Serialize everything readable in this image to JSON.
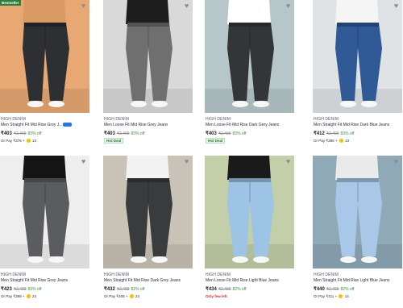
{
  "products": [
    {
      "badge": "Bestseller",
      "brand": "HIGH DENIM",
      "title": "Men Straight Fit Mid Rise Grey J...",
      "assured": true,
      "assured_label": "Assured",
      "price": "₹403",
      "mrp": "₹2,499",
      "discount": "83% off",
      "tag": "",
      "pay_prefix": "Or Pay",
      "pay_amount": "₹376",
      "coins": "13",
      "colors": {
        "bg": "#e7a873",
        "jeans": "#2d2f33",
        "top": "#d99a65"
      }
    },
    {
      "badge": "",
      "brand": "HIGH DENIM",
      "title": "Men Loose Fit Mid Rise Grey Jeans",
      "assured": false,
      "price": "₹403",
      "mrp": "₹2,499",
      "discount": "83% off",
      "tag": "Hot Deal",
      "pay_prefix": "",
      "pay_amount": "",
      "coins": "",
      "colors": {
        "bg": "#d9d9d9",
        "jeans": "#6f6f6f",
        "top": "#1d1d1d"
      }
    },
    {
      "badge": "",
      "brand": "HIGH DENIM",
      "title": "Men Loose Fit Mid Rise Dark Grey Jeans",
      "assured": false,
      "price": "₹403",
      "mrp": "₹2,499",
      "discount": "83% off",
      "tag": "Hot Deal",
      "pay_prefix": "",
      "pay_amount": "",
      "coins": "",
      "colors": {
        "bg": "#b7c7c9",
        "jeans": "#343537",
        "top": "#ffffff"
      }
    },
    {
      "badge": "",
      "brand": "HIGH DENIM",
      "title": "Men Straight Fit Mid Rise Dark Blue Jeans",
      "assured": false,
      "price": "₹412",
      "mrp": "₹2,499",
      "discount": "83% off",
      "tag": "",
      "pay_prefix": "Or Pay",
      "pay_amount": "₹385",
      "coins": "13",
      "colors": {
        "bg": "#dfe3e6",
        "jeans": "#2f5a96",
        "top": "#f5f5f5"
      }
    },
    {
      "badge": "",
      "brand": "HIGH DENIM",
      "title": "Men Straight Fit Mid Rise Grey Jeans",
      "assured": false,
      "price": "₹423",
      "mrp": "₹2,499",
      "discount": "83% off",
      "tag": "",
      "pay_prefix": "Or Pay",
      "pay_amount": "₹399",
      "coins": "24",
      "colors": {
        "bg": "#eeeeee",
        "jeans": "#5a5c60",
        "top": "#141414"
      }
    },
    {
      "badge": "",
      "brand": "HIGH DENIM",
      "title": "Men Straight Fit Mid Rise Dark Grey Jeans",
      "assured": false,
      "price": "₹432",
      "mrp": "₹2,499",
      "discount": "82% off",
      "tag": "",
      "pay_prefix": "Or Pay",
      "pay_amount": "₹408",
      "coins": "24",
      "colors": {
        "bg": "#c9c2b6",
        "jeans": "#3a3b3d",
        "top": "#f2f2f2"
      }
    },
    {
      "badge": "",
      "brand": "HIGH DENIM",
      "title": "Men Loose Fit Mid Rise Light Blue Jeans",
      "assured": false,
      "price": "₹434",
      "mrp": "₹2,499",
      "discount": "82% off",
      "tag": "Only few left",
      "pay_prefix": "",
      "pay_amount": "",
      "coins": "",
      "colors": {
        "bg": "#c2cfa8",
        "jeans": "#9dc4e4",
        "top": "#1a1a1a"
      }
    },
    {
      "badge": "",
      "brand": "HIGH DENIM",
      "title": "Men Straight Fit Mid Rise Light Blue Jeans",
      "assured": false,
      "price": "₹440",
      "mrp": "₹2,499",
      "discount": "82% off",
      "tag": "",
      "pay_prefix": "Or Pay",
      "pay_amount": "₹411",
      "coins": "14",
      "colors": {
        "bg": "#8fa9b7",
        "jeans": "#a9c8e8",
        "top": "#eaeaea"
      }
    }
  ]
}
